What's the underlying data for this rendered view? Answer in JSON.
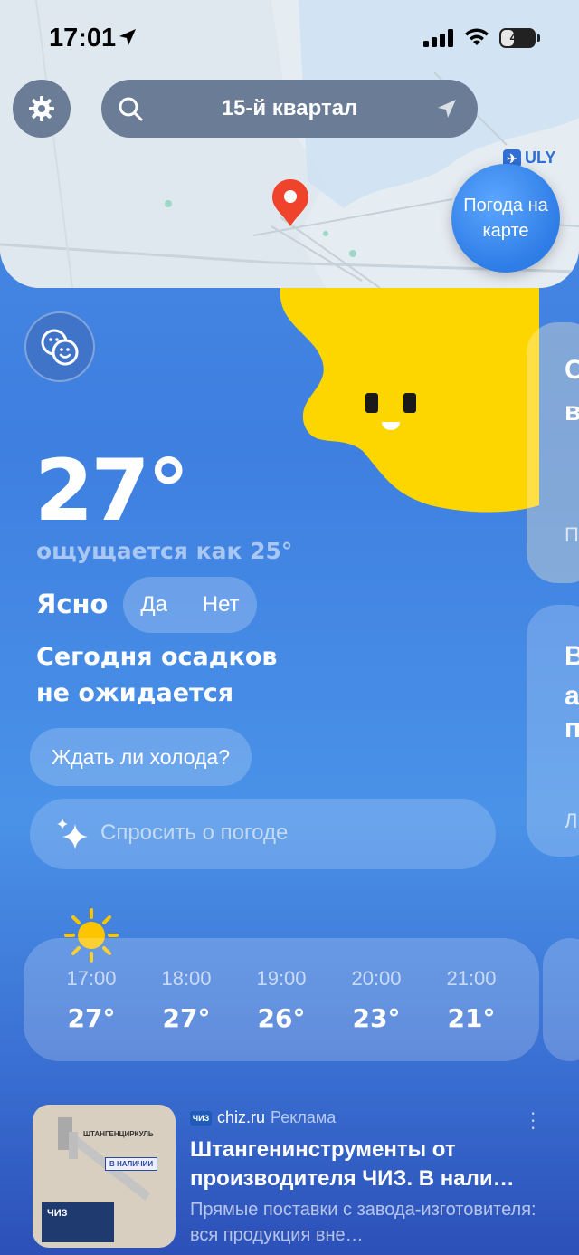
{
  "status_bar": {
    "time": "17:01",
    "battery": "40",
    "battery_level": 0.4
  },
  "search": {
    "location": "15-й квартал"
  },
  "map": {
    "airport_label": "ULY",
    "weather_map_button": "Погода на карте"
  },
  "current": {
    "temperature": "27°",
    "feels_like": "ощущается как 25°",
    "condition": "Ясно",
    "yes_label": "Да",
    "no_label": "Нет",
    "precip_line1": "Сегодня осадков",
    "precip_line2": "не ожидается"
  },
  "side_cards": [
    {
      "line1": "С",
      "line2": "в",
      "line3": "П"
    },
    {
      "line1": "В",
      "line2": "а",
      "line3": "п",
      "line4": "Л"
    }
  ],
  "chips": {
    "cold_question": "Ждать ли холода?",
    "ask_placeholder": "Спросить о погоде"
  },
  "hourly": [
    {
      "time": "17:00",
      "temp": "27°"
    },
    {
      "time": "18:00",
      "temp": "27°"
    },
    {
      "time": "19:00",
      "temp": "26°"
    },
    {
      "time": "20:00",
      "temp": "23°"
    },
    {
      "time": "21:00",
      "temp": "21°"
    }
  ],
  "ad": {
    "source": "chiz.ru",
    "source_logo": "ЧИЗ",
    "label": "Реклама",
    "title": "Штангенинструменты от производителя ЧИЗ. В нали…",
    "description": "Прямые поставки с завода-изготовителя: вся продукция вне…",
    "image_text_1": "ШТАНГЕНЦИРКУЛЬ",
    "image_text_2": "В НАЛИЧИИ",
    "image_brand": "ЧИЗ"
  },
  "colors": {
    "accent_blue": "#2e7de6",
    "sun_yellow": "#fdd600",
    "pin_red": "#f0432c"
  }
}
